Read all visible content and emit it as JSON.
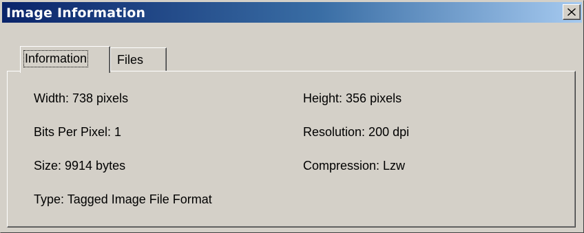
{
  "window": {
    "title": "Image Information",
    "close_symbol": "X"
  },
  "tabs": [
    {
      "label": "Information",
      "active": true
    },
    {
      "label": "Files",
      "active": false
    }
  ],
  "info": {
    "width": "Width: 738 pixels",
    "height": "Height: 356 pixels",
    "bits_per_pixel": "Bits Per Pixel: 1",
    "resolution": "Resolution: 200 dpi",
    "size": "Size: 9914 bytes",
    "compression": "Compression: Lzw",
    "type": "Type: Tagged Image File Format"
  },
  "colors": {
    "face": "#d4d0c8",
    "title_start": "#0a246a",
    "title_end": "#a6caf0"
  },
  "icons": {
    "close": "close-icon"
  }
}
